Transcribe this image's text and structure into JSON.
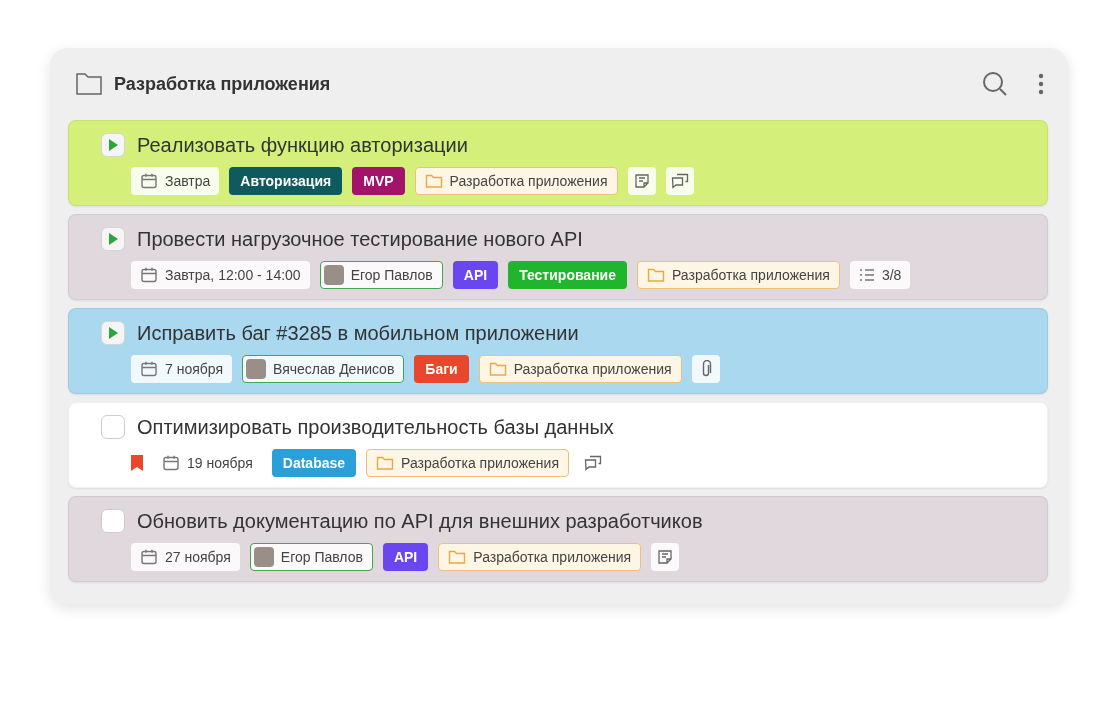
{
  "header": {
    "title": "Разработка приложения"
  },
  "tasks": [
    {
      "kind": "running",
      "color": "#d4f07a",
      "title": "Реализовать функцию авторизации",
      "chips": [
        {
          "kind": "date",
          "text": "Завтра"
        },
        {
          "kind": "tag",
          "text": "Авторизация",
          "color": "#0f5a5e"
        },
        {
          "kind": "tag",
          "text": "MVP",
          "color": "#a3136b"
        },
        {
          "kind": "project",
          "text": "Разработка приложения"
        },
        {
          "kind": "note"
        },
        {
          "kind": "comments"
        }
      ]
    },
    {
      "kind": "running",
      "color": "#e0d8dd",
      "title": "Провести нагрузочное тестирование нового API",
      "chips": [
        {
          "kind": "date",
          "text": "Завтра, 12:00 - 14:00"
        },
        {
          "kind": "person",
          "text": "Егор Павлов"
        },
        {
          "kind": "tag",
          "text": "API",
          "color": "#6b46f0"
        },
        {
          "kind": "tag",
          "text": "Тестирование",
          "color": "#1fb52c"
        },
        {
          "kind": "project",
          "text": "Разработка приложения"
        },
        {
          "kind": "subtasks",
          "text": "3/8"
        }
      ]
    },
    {
      "kind": "running",
      "color": "#a9d8ef",
      "title": "Исправить баг #3285 в мобильном приложении",
      "chips": [
        {
          "kind": "date",
          "text": "7 ноября"
        },
        {
          "kind": "person",
          "text": "Вячеслав Денисов"
        },
        {
          "kind": "tag",
          "text": "Баги",
          "color": "#e8472b"
        },
        {
          "kind": "project",
          "text": "Разработка приложения"
        },
        {
          "kind": "attachment"
        }
      ]
    },
    {
      "kind": "todo",
      "color": "#ffffff",
      "title": "Оптимизировать производительность базы данных",
      "chips": [
        {
          "kind": "flag"
        },
        {
          "kind": "date",
          "text": "19 ноября"
        },
        {
          "kind": "tag",
          "text": "Database",
          "color": "#2a9fd8"
        },
        {
          "kind": "project",
          "text": "Разработка приложения"
        },
        {
          "kind": "comments"
        }
      ]
    },
    {
      "kind": "todo",
      "color": "#e0d8dd",
      "title": "Обновить документацию по API для внешних разработчиков",
      "chips": [
        {
          "kind": "date",
          "text": "27 ноября"
        },
        {
          "kind": "person",
          "text": "Егор Павлов"
        },
        {
          "kind": "tag",
          "text": "API",
          "color": "#6b46f0"
        },
        {
          "kind": "project",
          "text": "Разработка приложения"
        },
        {
          "kind": "note"
        }
      ]
    }
  ]
}
